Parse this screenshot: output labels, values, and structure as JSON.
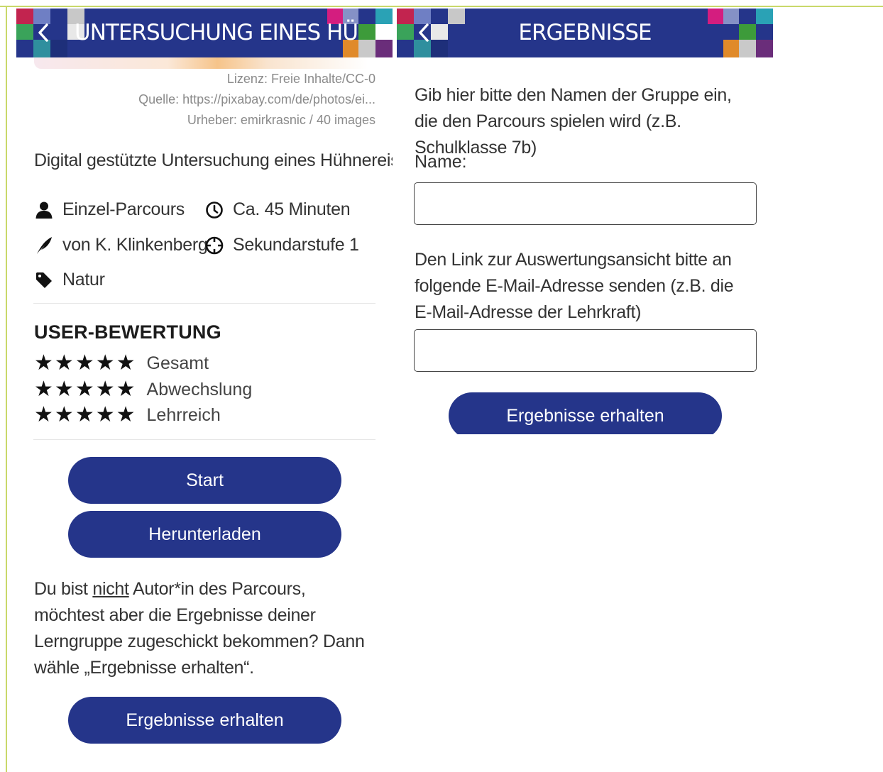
{
  "colors": {
    "header_bg": "#25358a",
    "button_bg": "#25358a",
    "frame": "#c9d86a"
  },
  "left_screen": {
    "header_title": "UNTERSUCHUNG EINES HÜHNEREIS",
    "back_icon": "chevron-left-icon",
    "license": "Lizenz: Freie Inhalte/CC-0",
    "source": "Quelle: https://pixabay.com/de/photos/ei...",
    "author_credit": "Urheber: emirkrasnic / 40 images",
    "description": "Digital gestützte Untersuchung eines Hühnereis",
    "meta": {
      "mode": "Einzel-Parcours",
      "duration": "Ca. 45 Minuten",
      "author": "von K. Klinkenberg",
      "level": "Sekundarstufe 1",
      "category": "Natur"
    },
    "rating_title": "USER-BEWERTUNG",
    "ratings": [
      {
        "label": "Gesamt",
        "stars": 5
      },
      {
        "label": "Abwechslung",
        "stars": 5
      },
      {
        "label": "Lehrreich",
        "stars": 5
      }
    ],
    "start_button": "Start",
    "download_button": "Herunterladen",
    "info_text_1": "Du bist ",
    "info_text_underlined": "nicht",
    "info_text_2": " Autor*in des Parcours, möchtest aber die Ergebnisse deiner Lerngruppe zugeschickt bekommen? Dann wähle „Ergebnisse erhalten“.",
    "results_button": "Ergebnisse erhalten"
  },
  "right_screen": {
    "header_title": "ERGEBNISSE",
    "back_icon": "chevron-left-icon",
    "intro": "Gib hier bitte den Namen der Gruppe ein, die den Parcours spielen wird (z.B. Schulklasse 7b)",
    "name_label": "Name:",
    "name_value": "",
    "email_label": "Den Link zur Auswertungsansicht bitte an folgende E-Mail-Adresse senden (z.B. die E-Mail-Adresse der Lehrkraft)",
    "email_value": "",
    "submit_button": "Ergebnisse erhalten"
  }
}
